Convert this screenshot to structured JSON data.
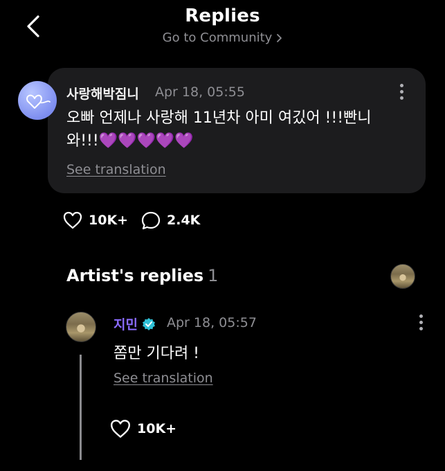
{
  "header": {
    "title": "Replies",
    "subtitle": "Go to Community"
  },
  "post": {
    "author": "사랑해박짐니",
    "timestamp": "Apr 18, 05:55",
    "body_line1": "오빠 언제나 사랑해 11년차 아미 여깄어 !!!빤니",
    "body_line2": "와!!!",
    "emoji": "💜💜💜💜💜",
    "see_translation": "See translation",
    "likes": "10K+",
    "comments": "2.4K"
  },
  "artist_replies": {
    "title": "Artist's replies",
    "count": "1",
    "reply": {
      "author": "지민",
      "timestamp": "Apr 18, 05:57",
      "body": "쫌만 기다려 !",
      "see_translation": "See translation",
      "likes": "10K+"
    }
  },
  "colors": {
    "background": "#000000",
    "card": "#1c1c1e",
    "artist_name": "#8b6cff",
    "verified_badge": "#2fc0d6",
    "muted_text": "#8e8e93"
  },
  "icons": [
    "back-chevron-icon",
    "chevron-right-icon",
    "kebab-menu-icon",
    "heart-icon",
    "comment-bubble-icon",
    "verified-badge-icon"
  ]
}
